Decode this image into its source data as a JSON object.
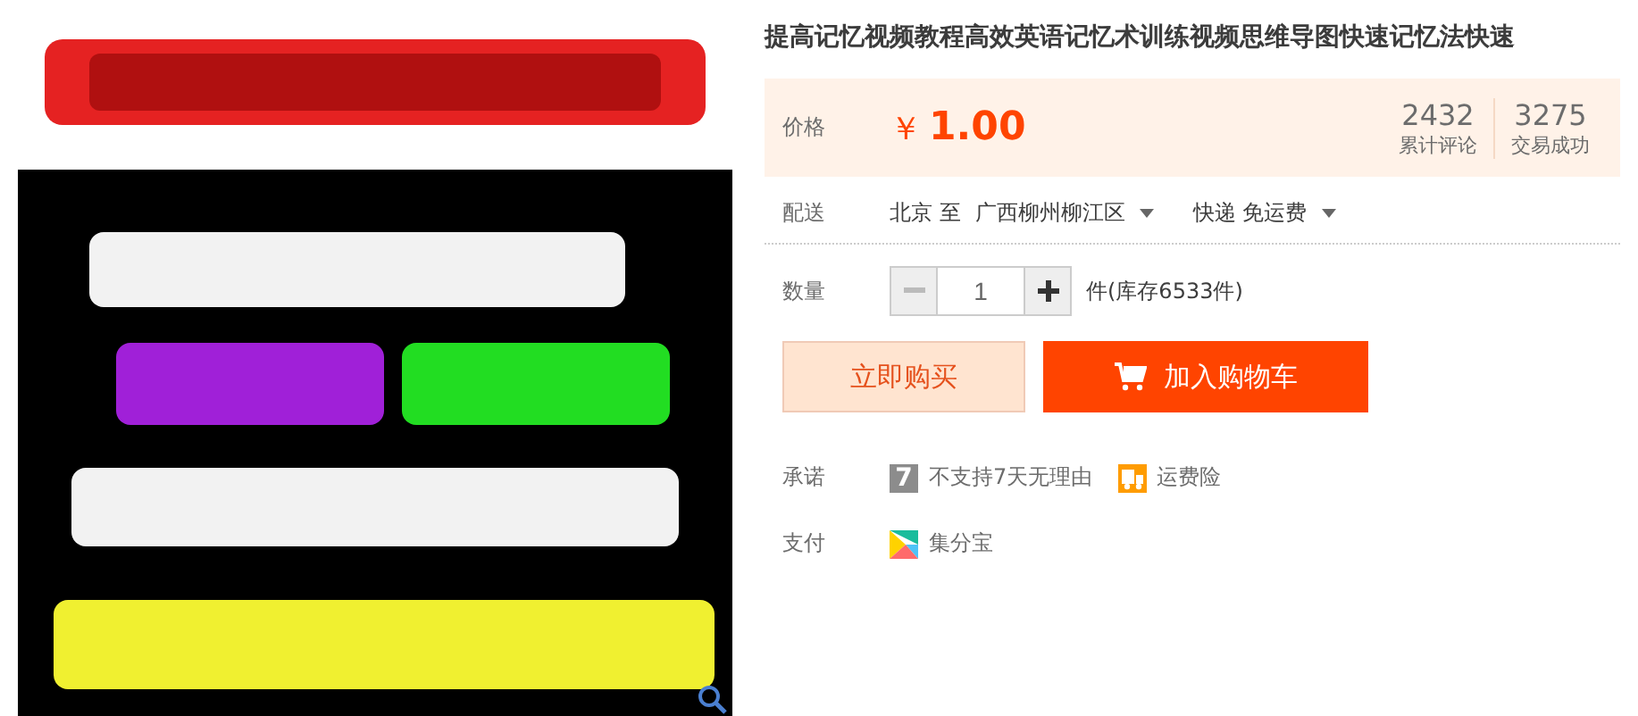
{
  "title": "提高记忆视频教程高效英语记忆术训练视频思维导图快速记忆法快速",
  "price": {
    "label": "价格",
    "currency": "￥",
    "amount": "1.00"
  },
  "stats": [
    {
      "value": "2432",
      "label": "累计评论"
    },
    {
      "value": "3275",
      "label": "交易成功"
    }
  ],
  "delivery": {
    "label": "配送",
    "from": "北京 至",
    "to": "广西柳州柳江区",
    "shipping": "快递 免运费"
  },
  "quantity": {
    "label": "数量",
    "minus_disabled": true,
    "value": "1",
    "stock": "件(库存6533件)"
  },
  "buttons": [
    {
      "kind": "buy",
      "label": "立即购买"
    },
    {
      "kind": "cart",
      "label": "加入购物车"
    }
  ],
  "promise": {
    "label": "承诺",
    "items": [
      {
        "kind": "seven",
        "icon_text": "7",
        "text": "不支持7天无理由"
      },
      {
        "kind": "truck",
        "text": "运费险"
      }
    ]
  },
  "payment": {
    "label": "支付",
    "items": [
      {
        "kind": "jifenbao",
        "text": "集分宝"
      }
    ]
  }
}
